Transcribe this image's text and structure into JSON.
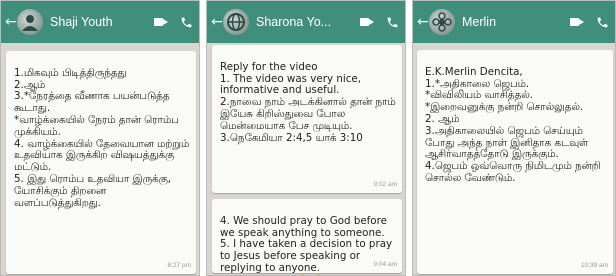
{
  "panels": [
    {
      "contact": "Shaji Youth",
      "messages": [
        {
          "text": "1.மிகவும் பிடித்திருந்தது\n2.ஆம்\n3.*நேரத்தை வீணாக பயன்படுத்த கூடாது.\n*வாழ்க்கையில் நேரம் தான் ரொம்ப முக்கியம்.\n4. வாழ்க்கையில் தேவையான மற்றும் உதவியாக இருக்கிற விஷயத்துக்கு மட்டும்.\n5. இது ரொம்ப உதவியா இருக்கு, யோசிக்கும் திறனை வளப்படுத்துகிறது.",
          "time": "8:27 pm"
        }
      ]
    },
    {
      "contact": "Sharona Yo...",
      "messages": [
        {
          "text": "Reply for the video\n1. The video was very nice, informative and useful.\n2.நாவை நாம் அடக்கினால் தான் நாம் இயேசு கிறிஸ்துவை போல மென்மையாக பேச முடியும்.\n3.நெகேமியா 2:4,5 யாக் 3:10",
          "time": "9:02 am"
        },
        {
          "text": "4. We should pray to God before we speak anything to someone.\n5. I have taken a decision to pray to Jesus before speaking or replying to anyone.\nThank u sister 🙏 🙏",
          "time": "9:04 am"
        }
      ]
    },
    {
      "contact": "Merlin",
      "messages": [
        {
          "text": "E.K.Merlin Dencita,\n1.*அதிகாலை ஜெபம்.\n*விவிலியம் வாசித்தல்.\n*இறைவனுக்கு நன்றி சொல்லுதல்.\n2. ஆம்\n3.அதிகாலையில் ஜெபம் செய்யும் போது அந்த நாள் இனிதாக கடவுள் ஆசிர்வாதத்தோடு இருக்கும்.\n4.ஜெபம் ஒவ்வொரு நிமிடமும் நன்றி சொல்ல வேண்டும்.",
          "time": "10:39 am"
        }
      ]
    }
  ],
  "colors": {
    "header": "#3f8f7c",
    "chat_bg": "#d9d6cf",
    "bubble": "#fafaf7"
  }
}
